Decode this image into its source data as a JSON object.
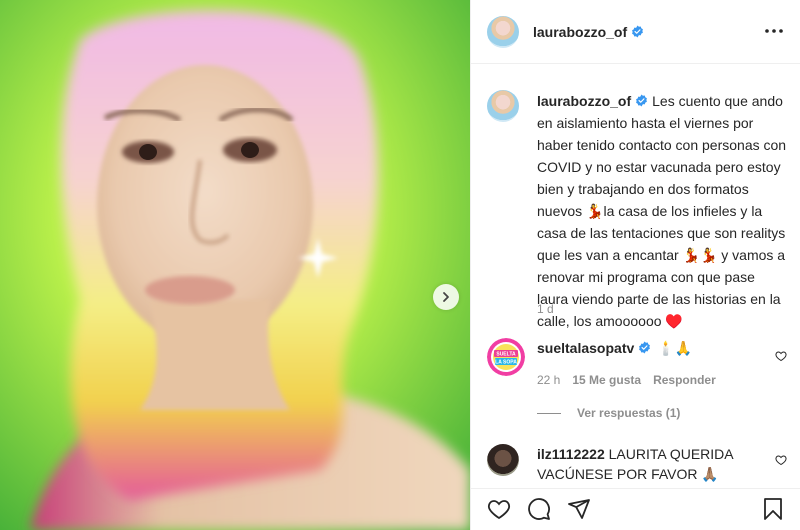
{
  "post": {
    "username": "laurabozzo_of",
    "caption": "Les cuento que ando en aislamiento hasta el viernes por haber tenido contacto con personas con COVID y no estar vacunada pero estoy bien y trabajando en dos formatos nuevos 💃la casa de los infieles y la casa de las tentaciones que son realitys que les van a encantar 💃💃 y vamos a renovar mi programa con que pase laura viendo parte de las historias en la calle, los amoooooo ♥️",
    "age": "1 d"
  },
  "comments": [
    {
      "username": "sueltalasopatv",
      "text": "🕯️🙏",
      "time": "22 h",
      "likes": "15 Me gusta",
      "reply_label": "Responder",
      "view_replies": "Ver respuestas (1)",
      "avatar_label": "SUELTA LA SOPA"
    },
    {
      "username": "ilz1112222",
      "text": "LAURITA QUERIDA VACÚNESE POR FAVOR 🙏🏽"
    }
  ],
  "icons": {
    "verified": "verified-badge-icon",
    "more": "more-options-icon",
    "next": "chevron-right-icon",
    "like": "heart-icon",
    "comment": "comment-icon",
    "share": "paper-plane-icon",
    "save": "bookmark-icon"
  },
  "colors": {
    "verified": "#3897f0",
    "meta_text": "#8e8e8e",
    "text": "#262626",
    "divider": "#efefef"
  }
}
